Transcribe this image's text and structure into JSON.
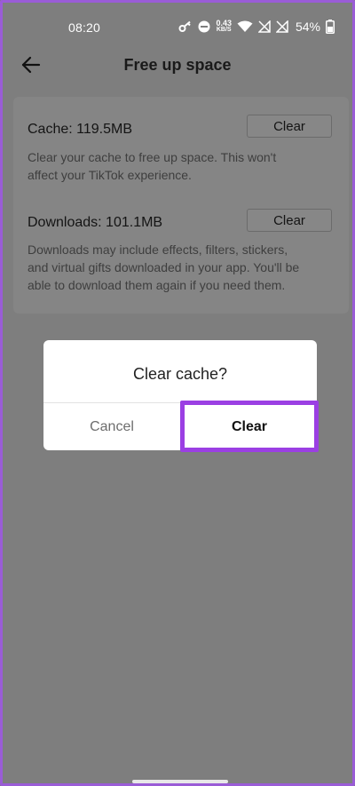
{
  "status_bar": {
    "time": "08:20",
    "net_speed_value": "0.43",
    "net_speed_unit": "KB/S",
    "battery": "54%",
    "icons": [
      "key-icon",
      "dnd-icon",
      "wifi-icon",
      "no-sim-icon",
      "no-sim-icon",
      "battery-icon"
    ]
  },
  "header": {
    "title": "Free up space",
    "back_icon": "arrow-left-icon"
  },
  "cache": {
    "title": "Cache: 119.5MB",
    "description_line1": "Clear your cache to free up space. This won't",
    "description_line2": "affect your TikTok experience.",
    "button": "Clear"
  },
  "downloads": {
    "title": "Downloads: 101.1MB",
    "description_line1": "Downloads may include effects, filters, stickers,",
    "description_line2": "and virtual gifts downloaded in your app. You'll be",
    "description_line3": "able to download them again if you need them.",
    "button": "Clear"
  },
  "dialog": {
    "title": "Clear cache?",
    "cancel": "Cancel",
    "confirm": "Clear"
  },
  "colors": {
    "highlight": "#9b3fe3",
    "overlay": "#7e7e7e",
    "dialog_bg": "#ffffff"
  }
}
